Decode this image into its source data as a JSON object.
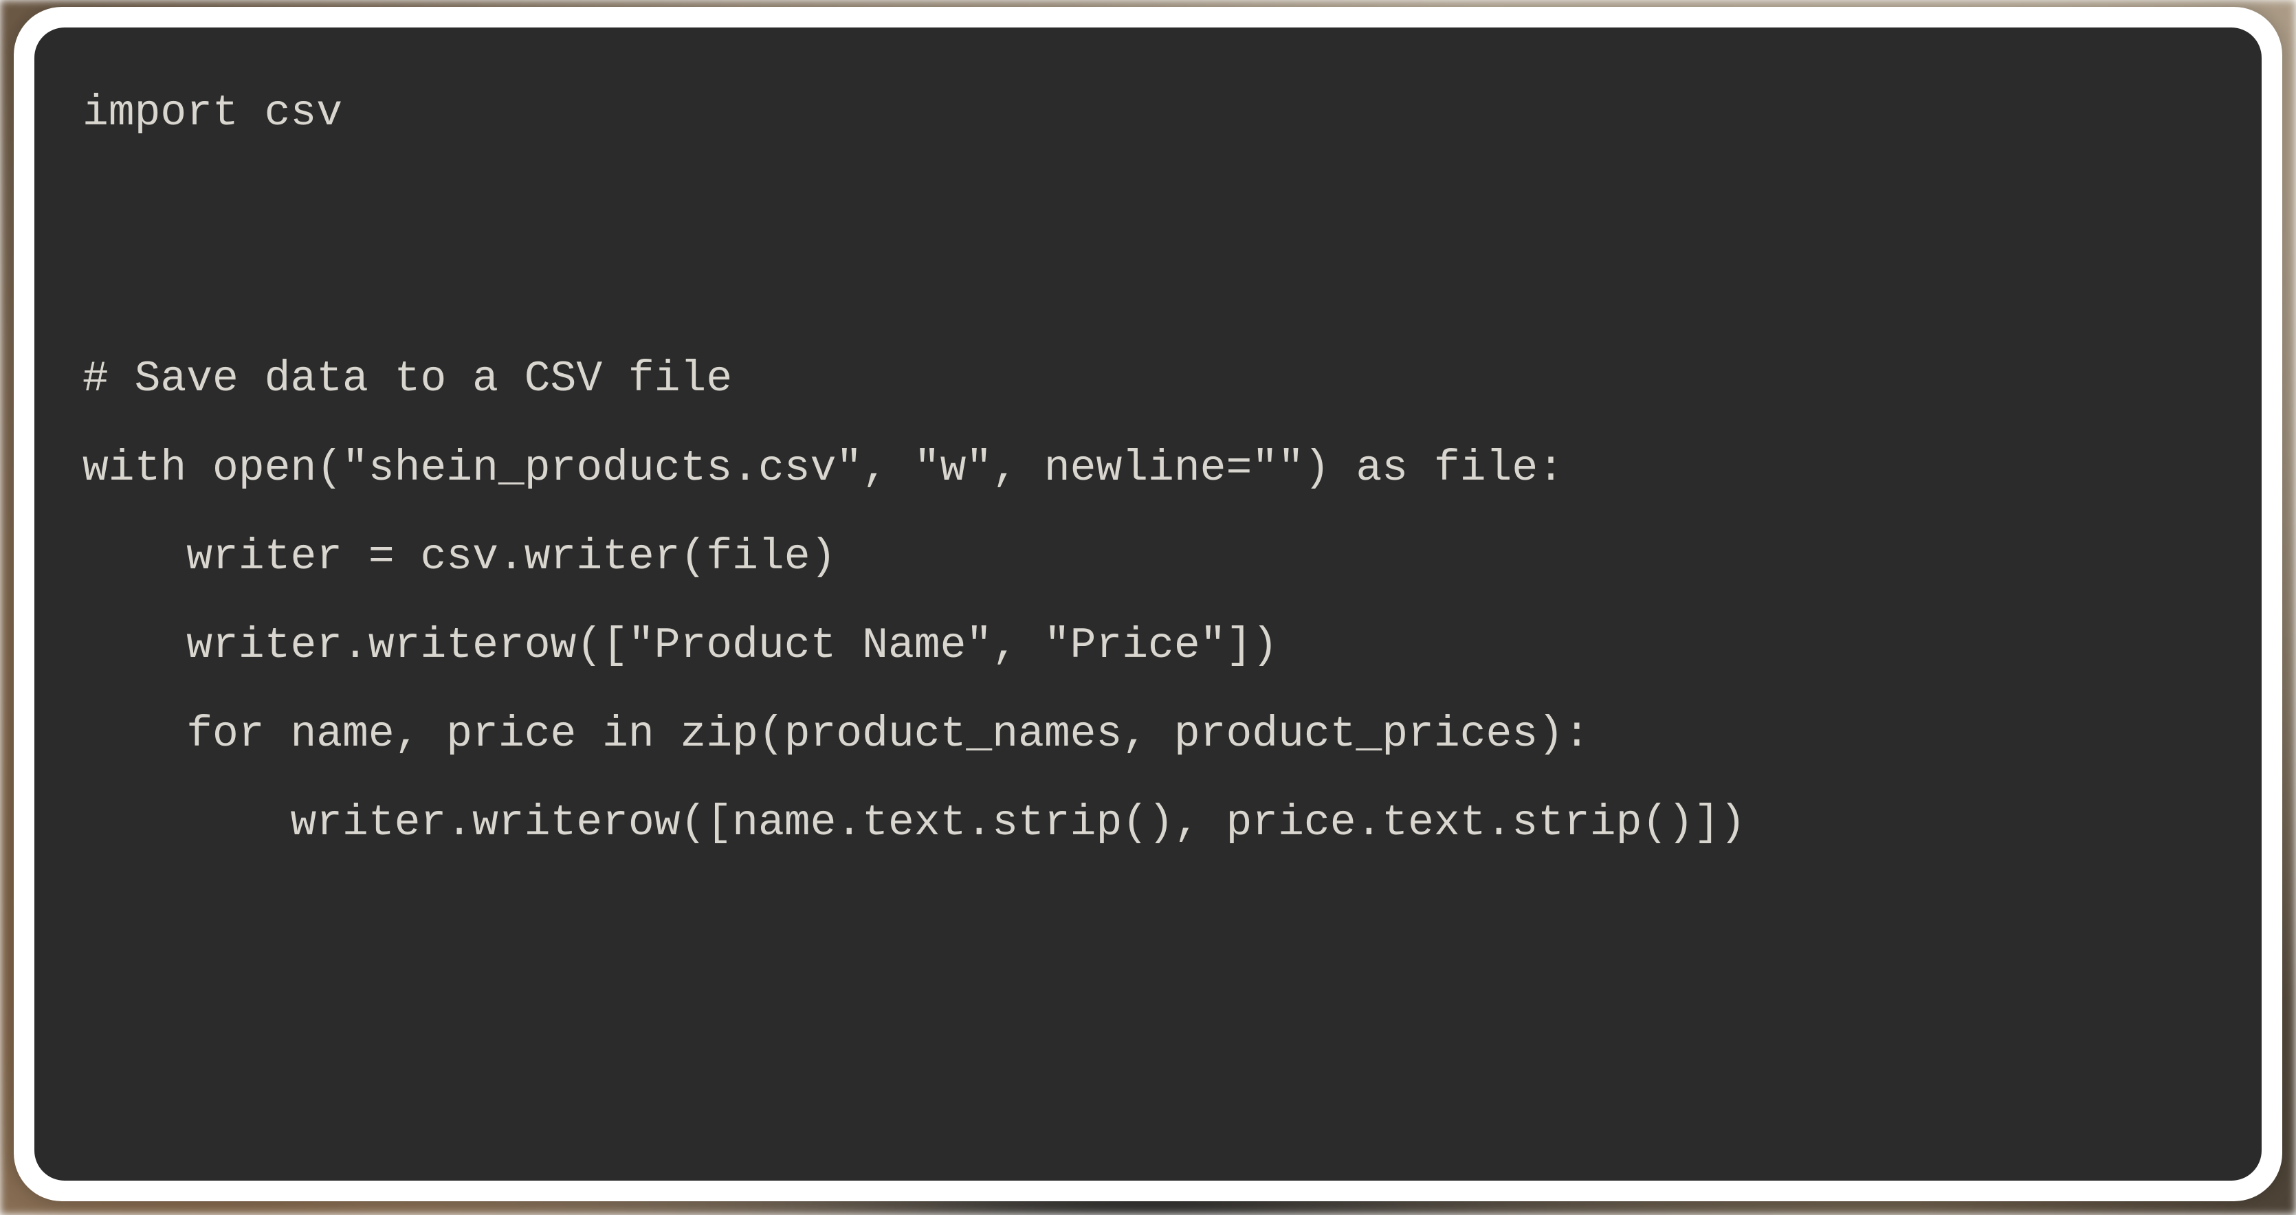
{
  "code": {
    "language": "python",
    "lines": [
      "import csv",
      "",
      "",
      "# Save data to a CSV file",
      "with open(\"shein_products.csv\", \"w\", newline=\"\") as file:",
      "    writer = csv.writer(file)",
      "    writer.writerow([\"Product Name\", \"Price\"])",
      "    for name, price in zip(product_names, product_prices):",
      "        writer.writerow([name.text.strip(), price.text.strip()])"
    ]
  },
  "colors": {
    "panel_bg": "#2b2b2b",
    "panel_border": "#ffffff",
    "code_text": "#d9d6cf"
  }
}
